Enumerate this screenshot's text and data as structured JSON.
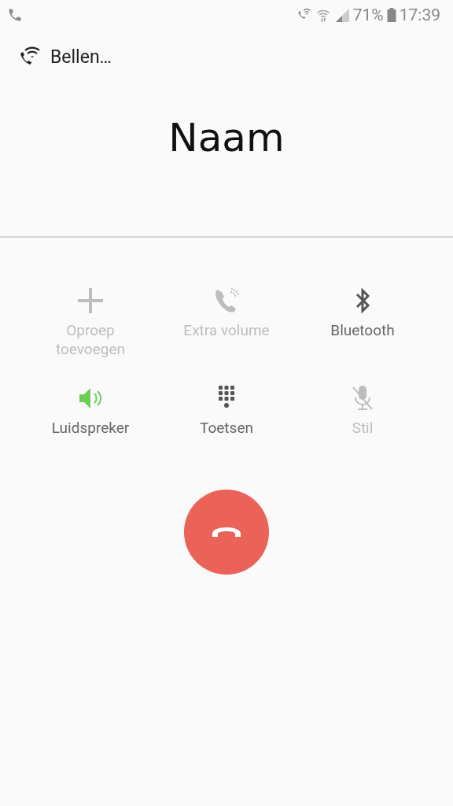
{
  "status_bar": {
    "battery": "71%",
    "time": "17:39"
  },
  "call_status": {
    "label": "Bellen…"
  },
  "caller": {
    "name": "Naam"
  },
  "controls": [
    {
      "kind": "add",
      "label": "Oproep toevoegen",
      "disabled": true,
      "on": false
    },
    {
      "kind": "volume",
      "label": "Extra volume",
      "disabled": true,
      "on": false
    },
    {
      "kind": "bluetooth",
      "label": "Bluetooth",
      "disabled": false,
      "on": false
    },
    {
      "kind": "speaker",
      "label": "Luidspreker",
      "disabled": false,
      "on": true
    },
    {
      "kind": "keypad",
      "label": "Toetsen",
      "disabled": false,
      "on": false
    },
    {
      "kind": "mute",
      "label": "Stil",
      "disabled": true,
      "on": false
    }
  ]
}
